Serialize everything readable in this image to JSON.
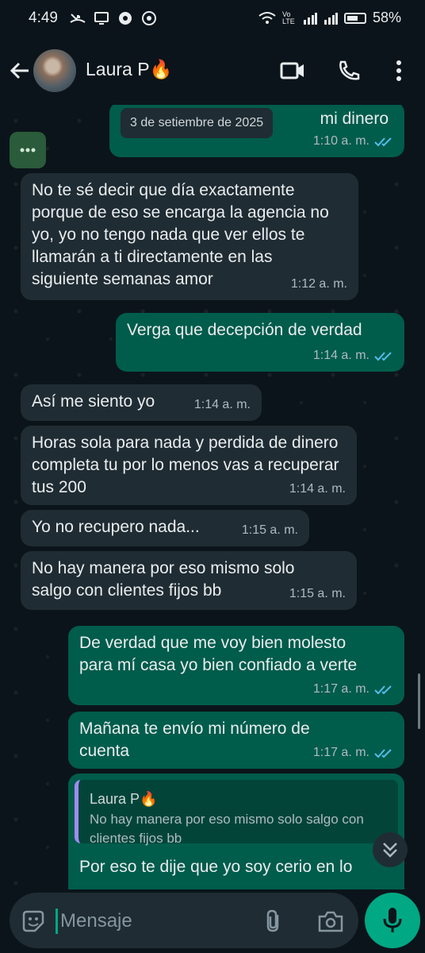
{
  "status_bar": {
    "time": "4:49",
    "battery": "58%",
    "network": "Vo LTE"
  },
  "header": {
    "contact_name": "Laura P🔥"
  },
  "date_chip": "3 de setiembre de 2025",
  "messages": [
    {
      "dir": "out",
      "text": "mi dinero",
      "time": "1:10 a. m."
    },
    {
      "dir": "in",
      "text": "No te sé decir que día exactamente porque de eso se encarga la agencia no yo, yo no tengo nada que ver ellos te llamarán a ti directamente en las siguiente semanas amor",
      "time": "1:12 a. m."
    },
    {
      "dir": "out",
      "text": "Verga que decepción de verdad",
      "time": "1:14 a. m."
    },
    {
      "dir": "in",
      "text": "Así me siento yo",
      "time": "1:14 a. m."
    },
    {
      "dir": "in",
      "text": "Horas sola para nada y perdida de dinero completa tu por lo menos vas a recuperar tus 200",
      "time": "1:14 a. m."
    },
    {
      "dir": "in",
      "text": "Yo no recupero nada...",
      "time": "1:15 a. m."
    },
    {
      "dir": "in",
      "text": "No hay manera por eso mismo solo salgo con clientes fijos bb",
      "time": "1:15 a. m."
    },
    {
      "dir": "out",
      "text": "De verdad que  me voy bien molesto para mí casa yo bien confiado a verte",
      "time": "1:17 a. m."
    },
    {
      "dir": "out",
      "text": "Mañana te envío mi número de cuenta",
      "time": "1:17 a. m."
    }
  ],
  "reply_message": {
    "quoted_name": "Laura P🔥",
    "quoted_text": "No hay manera por eso mismo solo salgo con clientes fijos bb",
    "text": "Por eso te dije que yo soy cerio en lo"
  },
  "input": {
    "placeholder": "Mensaje"
  },
  "colors": {
    "incoming": "#202c33",
    "outgoing": "#005c4b",
    "accent": "#00a884",
    "read_ticks": "#53bdeb"
  }
}
